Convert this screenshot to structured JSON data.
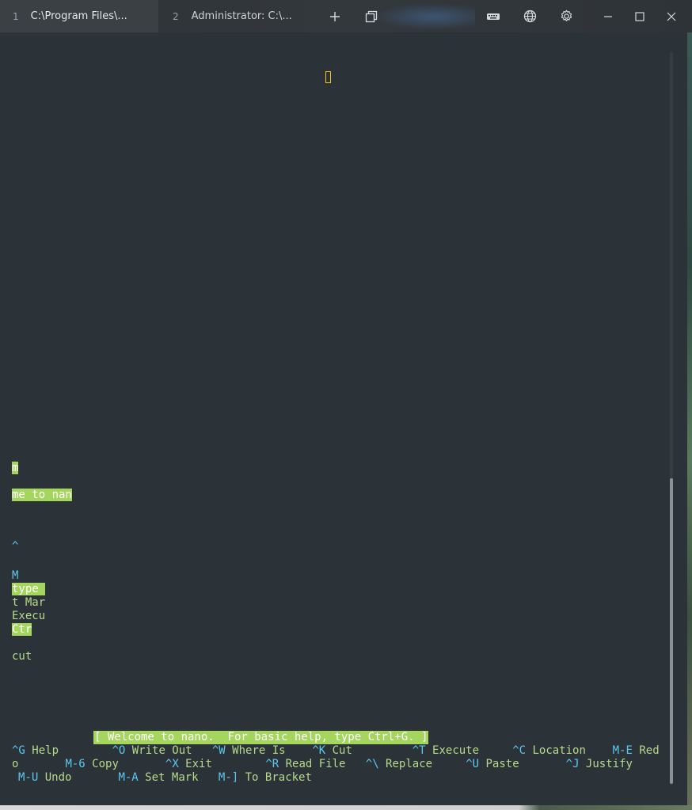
{
  "window": {
    "tabs": [
      {
        "number": "1",
        "label": "C:\\Program Files\\..."
      },
      {
        "number": "2",
        "label": "Administrator: C:\\..."
      }
    ]
  },
  "editor": {
    "fragments": [
      {
        "text": "m",
        "highlight": true
      },
      {
        "text": "me to nan",
        "highlight": true
      },
      {
        "text": "^",
        "highlight": false,
        "key": true
      },
      {
        "text": "M",
        "highlight": false,
        "key": true
      },
      {
        "text": "type ",
        "highlight": true
      },
      {
        "text": "t Mar",
        "highlight": false
      },
      {
        "text": "Execu",
        "highlight": false
      },
      {
        "text": "Ctr",
        "highlight": true
      },
      {
        "text": "cut",
        "highlight": false
      }
    ],
    "status_message": "[ Welcome to nano.  For basic help, type Ctrl+G. ]"
  },
  "shortcuts": {
    "row1": [
      {
        "key": "^G",
        "label": " Help        "
      },
      {
        "key": "^O",
        "label": " Write Out   "
      },
      {
        "key": "^W",
        "label": " Where Is    "
      },
      {
        "key": "^K",
        "label": " Cut         "
      },
      {
        "key": "^T",
        "label": " Execute     "
      },
      {
        "key": "^C",
        "label": " Location    "
      },
      {
        "key": "M-E",
        "label": " Red"
      }
    ],
    "row2_prefix": "o       ",
    "row2": [
      {
        "key": "M-6",
        "label": " Copy       "
      },
      {
        "key": "^X",
        "label": " Exit        "
      },
      {
        "key": "^R",
        "label": " Read File   "
      },
      {
        "key": "^\\",
        "label": " Replace     "
      },
      {
        "key": "^U",
        "label": " Paste       "
      },
      {
        "key": "^J",
        "label": " Justify"
      }
    ],
    "row3": [
      {
        "key": "M-U",
        "label": " Undo       "
      },
      {
        "key": "M-A",
        "label": " Set Mark   "
      },
      {
        "key": "M-]",
        "label": " To Bracket"
      }
    ]
  },
  "colors": {
    "background": "#2b3338",
    "highlight": "#a4d65e",
    "text": "#b7d98c",
    "key": "#5cc8f0",
    "cursor": "#f5c518"
  }
}
